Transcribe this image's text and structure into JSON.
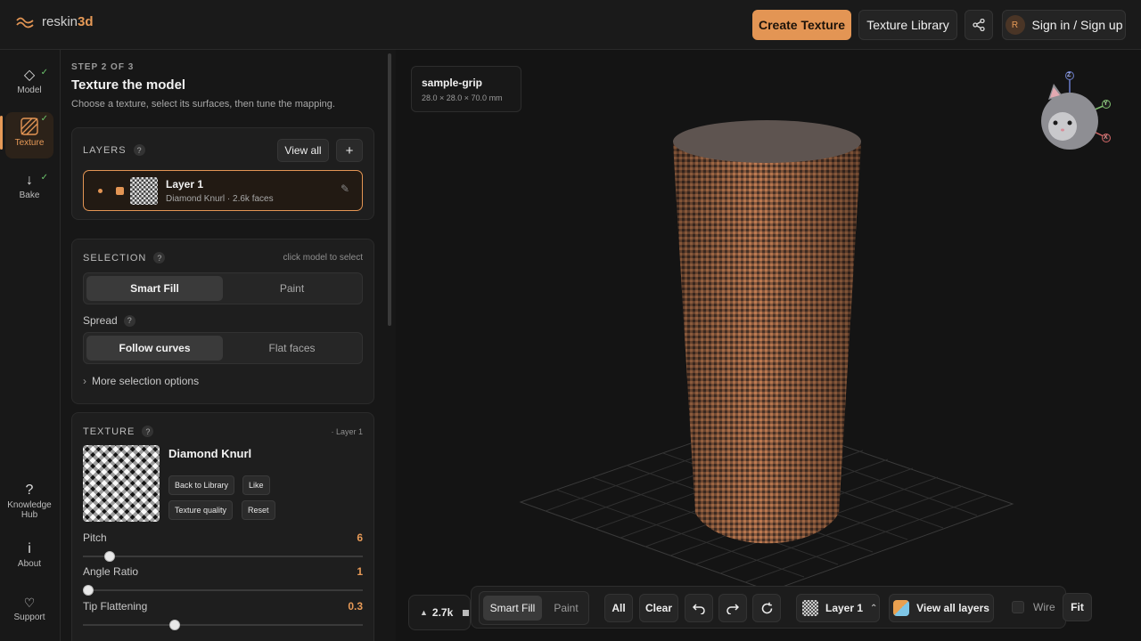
{
  "app": {
    "brand_prefix": "reskin",
    "brand_suffix": "3d"
  },
  "topbar": {
    "create_texture": "Create Texture",
    "texture_library": "Texture Library",
    "share_icon": "share-icon",
    "avatar_initial": "R",
    "sign_in": "Sign in / Sign up"
  },
  "rail": {
    "model": "Model",
    "texture": "Texture",
    "bake": "Bake",
    "knowledge_hub_1": "Knowledge",
    "knowledge_hub_2": "Hub",
    "about": "About",
    "support": "Support"
  },
  "panel": {
    "step": "STEP 2 OF 3",
    "title": "Texture the model",
    "subtitle": "Choose a texture, select its surfaces, then tune the mapping."
  },
  "layers": {
    "heading": "LAYERS",
    "view_all": "View all",
    "add": "+",
    "layer_name": "Layer 1",
    "layer_meta": "Diamond Knurl · 2.6k faces"
  },
  "selection": {
    "heading": "SELECTION",
    "hint": "click model to select",
    "mode_smart": "Smart Fill",
    "mode_paint": "Paint",
    "spread_label": "Spread",
    "spread_follow": "Follow curves",
    "spread_flat": "Flat faces",
    "more": "More selection options"
  },
  "texture": {
    "heading": "TEXTURE",
    "layer_ref": "· Layer 1",
    "name": "Diamond Knurl",
    "back_to_library": "Back to Library",
    "like": "Like",
    "quality": "Texture quality",
    "reset": "Reset",
    "sliders": [
      {
        "label": "Pitch",
        "value": "6",
        "fraction": 0.08
      },
      {
        "label": "Angle Ratio",
        "value": "1",
        "fraction": 0.0
      },
      {
        "label": "Tip Flattening",
        "value": "0.3",
        "fraction": 0.32
      }
    ]
  },
  "viewport": {
    "model_name": "sample-grip",
    "model_dims": "28.0 × 28.0 × 70.0 mm",
    "axis_z": "Z",
    "axis_y": "Y",
    "axis_x": "X",
    "face_count": "2.7k"
  },
  "bottombar": {
    "smart_fill": "Smart Fill",
    "paint": "Paint",
    "all": "All",
    "clear": "Clear",
    "layer": "Layer 1",
    "view_all_layers": "View all layers",
    "wire": "Wire",
    "fit": "Fit"
  },
  "colors": {
    "accent": "#e39554",
    "check": "#6cc46c"
  }
}
